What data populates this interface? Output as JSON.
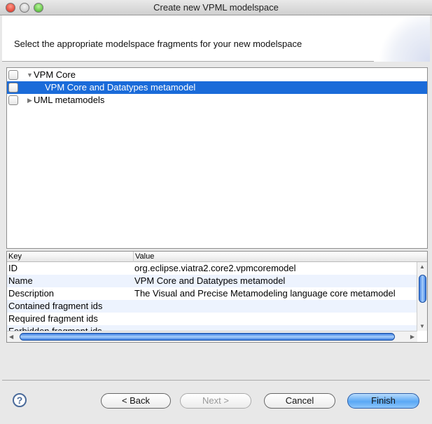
{
  "window": {
    "title": "Create new VPML modelspace"
  },
  "header": {
    "message": "Select the appropriate modelspace fragments for your new modelspace"
  },
  "tree": {
    "items": [
      {
        "label": "VPM Core",
        "expanded": true,
        "checked": false,
        "selected": false
      },
      {
        "label": "VPM Core and Datatypes metamodel",
        "checked": false,
        "selected": true
      },
      {
        "label": "UML metamodels",
        "expanded": false,
        "checked": false,
        "selected": false
      }
    ]
  },
  "properties": {
    "columns": [
      "Key",
      "Value"
    ],
    "rows": [
      {
        "key": "ID",
        "value": "org.eclipse.viatra2.core2.vpmcoremodel"
      },
      {
        "key": "Name",
        "value": "VPM Core and Datatypes metamodel"
      },
      {
        "key": "Description",
        "value": "The Visual and Precise Metamodeling language core metamodel"
      },
      {
        "key": "Contained fragment ids",
        "value": ""
      },
      {
        "key": "Required fragment ids",
        "value": ""
      },
      {
        "key": "Forbidden fragment ids",
        "value": ""
      }
    ]
  },
  "buttons": {
    "back": "< Back",
    "next": "Next >",
    "cancel": "Cancel",
    "finish": "Finish",
    "help": "?"
  },
  "colors": {
    "selection": "#1a6bd9",
    "default_button": "#5aa8f5"
  }
}
